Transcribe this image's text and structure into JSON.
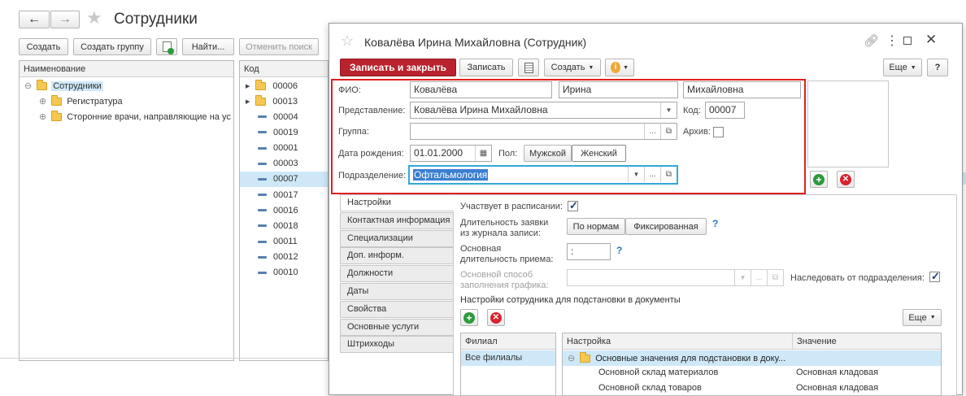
{
  "main": {
    "title": "Сотрудники",
    "toolbar": {
      "create": "Создать",
      "create_group": "Создать группу",
      "find": "Найти...",
      "cancel_search": "Отменить поиск"
    },
    "columns": {
      "name": "Наименование",
      "code": "Код"
    },
    "tree": {
      "root": "Сотрудники",
      "items": [
        "Регистратура",
        "Сторонние врачи, направляющие на ус"
      ]
    },
    "codes": [
      {
        "code": "00006",
        "type": "folder"
      },
      {
        "code": "00013",
        "type": "folder"
      },
      {
        "code": "00004",
        "type": "item"
      },
      {
        "code": "00019",
        "type": "item"
      },
      {
        "code": "00001",
        "type": "item"
      },
      {
        "code": "00003",
        "type": "item"
      },
      {
        "code": "00007",
        "type": "item"
      },
      {
        "code": "00017",
        "type": "item"
      },
      {
        "code": "00016",
        "type": "item"
      },
      {
        "code": "00018",
        "type": "item"
      },
      {
        "code": "00011",
        "type": "item"
      },
      {
        "code": "00012",
        "type": "item"
      },
      {
        "code": "00010",
        "type": "item"
      }
    ]
  },
  "dialog": {
    "title": "Ковалёва Ирина Михайловна (Сотрудник)",
    "toolbar": {
      "save_close": "Записать и закрыть",
      "save": "Записать",
      "create": "Создать",
      "more": "Еще",
      "help": "?"
    },
    "form": {
      "fio_label": "ФИО:",
      "last_name": "Ковалёва",
      "first_name": "Ирина",
      "middle_name": "Михайловна",
      "representation_label": "Представление:",
      "representation": "Ковалёва Ирина Михайловна",
      "code_label": "Код:",
      "code": "00007",
      "group_label": "Группа:",
      "group": "",
      "archive_label": "Архив:",
      "birthdate_label": "Дата рождения:",
      "birthdate": "01.01.2000",
      "gender_label": "Пол:",
      "male": "Мужской",
      "female": "Женский",
      "department_label": "Подразделение:",
      "department": "Офтальмология"
    },
    "tabs": [
      "Настройки",
      "Контактная информация",
      "Специализации",
      "Доп. информ.",
      "Должности",
      "Даты",
      "Свойства",
      "Основные услуги",
      "Штрихкоды"
    ],
    "settings": {
      "schedule_label": "Участвует в расписании:",
      "duration_label_1": "Длительность заявки",
      "duration_label_2": "из журнала записи:",
      "by_norms": "По нормам",
      "fixed": "Фиксированная",
      "base_duration_1": "Основная",
      "base_duration_2": "длительность приема:",
      "base_duration_value": ":",
      "fill_method_1": "Основной способ",
      "fill_method_2": "заполнения графика:",
      "inherit_label": "Наследовать от подразделения:",
      "section_title": "Настройки сотрудника для подстановки в документы",
      "more": "Еще",
      "branch_col": "Филиал",
      "branch_value": "Все филиалы",
      "setting_col": "Настройка",
      "value_col": "Значение",
      "rows": [
        {
          "setting": "Основные значения для подстановки в доку...",
          "value": ""
        },
        {
          "setting": "Основной склад материалов",
          "value": "Основная кладовая"
        },
        {
          "setting": "Основной склад товаров",
          "value": "Основная кладовая"
        }
      ]
    }
  },
  "colors": {
    "accent_red": "#b8232e",
    "highlight_border": "#e02020",
    "selection": "#cfe8f8",
    "focus_border": "#34a7d8"
  }
}
